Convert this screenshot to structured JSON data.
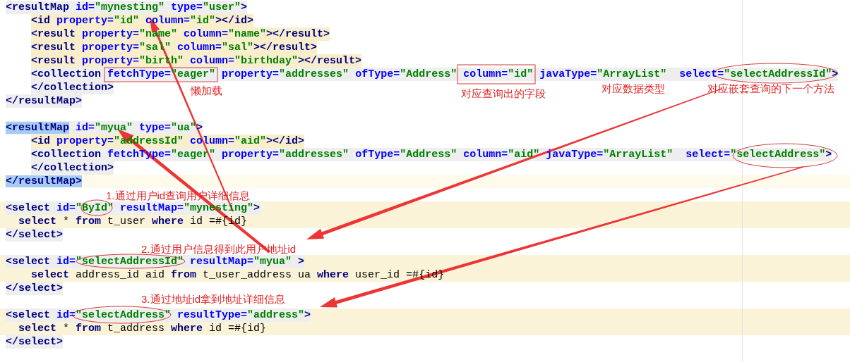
{
  "editor": {
    "lines": [
      {
        "color": "#eeeeee",
        "tokens": [
          {
            "kind": "tag",
            "text": "<resultMap"
          },
          {
            "kind": "attr",
            "text": " id="
          },
          {
            "kind": "value",
            "text": "\"mynesting\""
          },
          {
            "kind": "attr",
            "text": " type="
          },
          {
            "kind": "value",
            "text": "\"user\""
          },
          {
            "kind": "tag",
            "text": ">"
          }
        ]
      },
      {
        "kind": "child",
        "color": "#f8eecb",
        "tokens": [
          {
            "kind": "tag",
            "text": "<id"
          },
          {
            "kind": "attr",
            "text": " property="
          },
          {
            "kind": "value",
            "text": "\"id\""
          },
          {
            "kind": "attr",
            "text": " column="
          },
          {
            "kind": "value",
            "text": "\"id\""
          },
          {
            "kind": "tag",
            "text": "></id>"
          }
        ]
      },
      {
        "kind": "child",
        "color": "#f8eecb",
        "tokens": [
          {
            "kind": "tag",
            "text": "<result"
          },
          {
            "kind": "attr",
            "text": " property="
          },
          {
            "kind": "value",
            "text": "\"name\""
          },
          {
            "kind": "attr",
            "text": " column="
          },
          {
            "kind": "value",
            "text": "\"name\""
          },
          {
            "kind": "tag",
            "text": "></result>"
          }
        ]
      },
      {
        "kind": "child",
        "color": "#f8eecb",
        "tokens": [
          {
            "kind": "tag",
            "text": "<result"
          },
          {
            "kind": "attr",
            "text": " property="
          },
          {
            "kind": "value",
            "text": "\"sal\""
          },
          {
            "kind": "attr",
            "text": " column="
          },
          {
            "kind": "value",
            "text": "\"sal\""
          },
          {
            "kind": "tag",
            "text": "></result>"
          }
        ]
      },
      {
        "kind": "child",
        "color": "#f8eecb",
        "tokens": [
          {
            "kind": "tag",
            "text": "<result"
          },
          {
            "kind": "attr",
            "text": " property="
          },
          {
            "kind": "value",
            "text": "\"birth\""
          },
          {
            "kind": "attr",
            "text": " column="
          },
          {
            "kind": "value",
            "text": "\"birthday\""
          },
          {
            "kind": "tag",
            "text": "></result>"
          }
        ]
      },
      {
        "kind": "child",
        "color": "#eeeeee",
        "tokens": [
          {
            "kind": "tag",
            "text": "<collection"
          },
          {
            "kind": "attr",
            "text": " fetchType="
          },
          {
            "kind": "value",
            "text": "\"eager\""
          },
          {
            "kind": "attr",
            "text": " property="
          },
          {
            "kind": "value",
            "text": "\"addresses\""
          },
          {
            "kind": "attr",
            "text": " ofType="
          },
          {
            "kind": "value",
            "text": "\"Address\""
          },
          {
            "kind": "attr",
            "text": " column="
          },
          {
            "kind": "value",
            "text": "\"id\""
          },
          {
            "kind": "attr",
            "text": " javaType="
          },
          {
            "kind": "value",
            "text": "\"ArrayList\""
          },
          {
            "kind": "attr",
            "text": "  select="
          },
          {
            "kind": "value",
            "text": "\"selectAddressId\""
          },
          {
            "kind": "tag",
            "text": ">"
          }
        ]
      },
      {
        "kind": "child",
        "color": "#eeeeee",
        "tokens": [
          {
            "kind": "tag",
            "text": "</collection>"
          }
        ]
      },
      {
        "color": "#eeeeee",
        "tokens": [
          {
            "kind": "tag",
            "text": "</resultMap>"
          }
        ]
      },
      {
        "kind": "blank"
      },
      {
        "color": "#eeeeee",
        "tokens": [
          {
            "kind": "tag",
            "text": "<resultMap",
            "selected": true
          },
          {
            "kind": "attr",
            "text": " id="
          },
          {
            "kind": "value",
            "text": "\"myua\""
          },
          {
            "kind": "attr",
            "text": " type="
          },
          {
            "kind": "value",
            "text": "\"ua\""
          },
          {
            "kind": "tag",
            "text": ">"
          }
        ]
      },
      {
        "kind": "child",
        "color": "#f8eecb",
        "tokens": [
          {
            "kind": "tag",
            "text": "<id"
          },
          {
            "kind": "attr",
            "text": " property="
          },
          {
            "kind": "value",
            "text": "\"addressId\""
          },
          {
            "kind": "attr",
            "text": " column="
          },
          {
            "kind": "value",
            "text": "\"aid\""
          },
          {
            "kind": "tag",
            "text": "></id>"
          }
        ]
      },
      {
        "kind": "child",
        "color": "#eeeeee",
        "tokens": [
          {
            "kind": "tag",
            "text": "<collection"
          },
          {
            "kind": "attr",
            "text": " fetchType="
          },
          {
            "kind": "value",
            "text": "\"eager\""
          },
          {
            "kind": "attr",
            "text": " property="
          },
          {
            "kind": "value",
            "text": "\"addresses\""
          },
          {
            "kind": "attr",
            "text": " ofType="
          },
          {
            "kind": "value",
            "text": "\"Address\""
          },
          {
            "kind": "attr",
            "text": " column="
          },
          {
            "kind": "value",
            "text": "\"aid\""
          },
          {
            "kind": "attr",
            "text": " javaType="
          },
          {
            "kind": "value",
            "text": "\"ArrayList\""
          },
          {
            "kind": "attr",
            "text": "  select="
          },
          {
            "kind": "value",
            "text": "\"selectAddress\""
          },
          {
            "kind": "tag",
            "text": ">"
          }
        ]
      },
      {
        "kind": "child",
        "color": "#eeeeee",
        "tokens": [
          {
            "kind": "tag",
            "text": "</collection>"
          }
        ]
      },
      {
        "current": true,
        "tokens": [
          {
            "kind": "tag",
            "text": "</resultMap>",
            "selected": true
          }
        ]
      },
      {
        "kind": "blank"
      },
      {
        "band": true,
        "color": "#eeeeee",
        "tokens": [
          {
            "kind": "tag",
            "text": "<select"
          },
          {
            "kind": "attr",
            "text": " id="
          },
          {
            "kind": "value",
            "text": "\"ById\""
          },
          {
            "kind": "attr",
            "text": " resultMap="
          },
          {
            "kind": "value",
            "text": "\"mynesting\""
          },
          {
            "kind": "tag",
            "text": ">"
          }
        ]
      },
      {
        "kind": "body",
        "band": true,
        "tokens": [
          {
            "kind": "keyword",
            "text": "select"
          },
          {
            "kind": "plain",
            "text": " * "
          },
          {
            "kind": "keyword",
            "text": "from"
          },
          {
            "kind": "plain",
            "text": " t_user "
          },
          {
            "kind": "keyword",
            "text": "where"
          },
          {
            "kind": "plain",
            "text": " id =#{id}"
          }
        ]
      },
      {
        "color": "#eeeeee",
        "tokens": [
          {
            "kind": "tag",
            "text": "</select>"
          }
        ]
      },
      {
        "kind": "blank"
      },
      {
        "band": true,
        "color": "#eeeeee",
        "tokens": [
          {
            "kind": "tag",
            "text": "<select"
          },
          {
            "kind": "attr",
            "text": " id="
          },
          {
            "kind": "value",
            "text": "\"selectAddressId\""
          },
          {
            "kind": "attr",
            "text": " resultMap="
          },
          {
            "kind": "value",
            "text": "\"myua\""
          },
          {
            "kind": "tag",
            "text": " >"
          }
        ]
      },
      {
        "kind": "child",
        "band": true,
        "tokens": [
          {
            "kind": "keyword",
            "text": "select"
          },
          {
            "kind": "plain",
            "text": " address_id aid "
          },
          {
            "kind": "keyword",
            "text": "from"
          },
          {
            "kind": "plain",
            "text": " t_user_address ua "
          },
          {
            "kind": "keyword",
            "text": "where"
          },
          {
            "kind": "plain",
            "text": " user_id =#{id}"
          }
        ]
      },
      {
        "color": "#eeeeee",
        "tokens": [
          {
            "kind": "tag",
            "text": "</select>"
          }
        ]
      },
      {
        "kind": "blank"
      },
      {
        "band": true,
        "color": "#eeeeee",
        "tokens": [
          {
            "kind": "tag",
            "text": "<select"
          },
          {
            "kind": "attr",
            "text": " id="
          },
          {
            "kind": "value",
            "text": "\"selectAddress\""
          },
          {
            "kind": "attr",
            "text": " resultType="
          },
          {
            "kind": "value",
            "text": "\"address\""
          },
          {
            "kind": "tag",
            "text": ">"
          }
        ]
      },
      {
        "kind": "body",
        "band": true,
        "tokens": [
          {
            "kind": "keyword",
            "text": "select"
          },
          {
            "kind": "plain",
            "text": " * "
          },
          {
            "kind": "keyword",
            "text": "from"
          },
          {
            "kind": "plain",
            "text": " t_address "
          },
          {
            "kind": "keyword",
            "text": "where"
          },
          {
            "kind": "plain",
            "text": " id =#{id}"
          }
        ]
      },
      {
        "color": "#eeeeee",
        "tokens": [
          {
            "kind": "tag",
            "text": "</select>"
          }
        ]
      }
    ]
  },
  "annotations": [
    {
      "text": "懒加载"
    },
    {
      "text": "对应查询出的字段"
    },
    {
      "text": "对应数据类型"
    },
    {
      "text": "对应嵌套查询的下一个方法"
    },
    {
      "text": "1.通过用户id查询用户详细信息"
    },
    {
      "text": "2.通过用户信息得到此用户地址id"
    },
    {
      "text": "3.通过地址id拿到地址详细信息"
    }
  ]
}
